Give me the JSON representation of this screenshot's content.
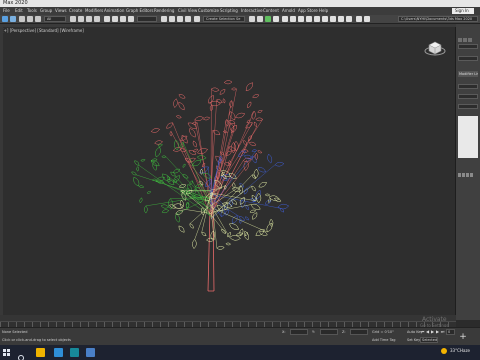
{
  "window": {
    "title": "Max 2020"
  },
  "menu": {
    "items": [
      "File",
      "Edit",
      "Tools",
      "Group",
      "Views",
      "Create",
      "Modifiers",
      "Animation",
      "Graph Editors",
      "Rendering",
      "Civil View",
      "Customize",
      "Scripting",
      "Interactive",
      "Content",
      "Arnold",
      "App Store",
      "Help"
    ],
    "sign_in": "Sign In"
  },
  "toolbar": {
    "selection_filter": "All",
    "named_selection": "Create Selection Se",
    "workspace_path": "C:\\Users\\NYHI\\Documents\\3ds Max 2020"
  },
  "viewport": {
    "label": "[+] [Perspective] [Standard] [Wireframe]"
  },
  "command_panel": {
    "modifier_list": "Modifier List"
  },
  "statusbar": {
    "selection_info": "None Selected",
    "hint": "Click or click-and-drag to select objects",
    "x_label": "X:",
    "y_label": "Y:",
    "z_label": "Z:",
    "grid": "Grid = 0'10\"",
    "add_time_tag": "Add Time Tag",
    "auto_key": "Auto Key",
    "set_key": "Set Key",
    "selected": "Selected",
    "frame": "0"
  },
  "watermark": {
    "line1": "Activate",
    "line2": "Go to Settings"
  },
  "taskbar": {
    "weather": "33°C",
    "condition": "Haze"
  },
  "colors": {
    "accent": "#f4b400",
    "viewport_bg": "#2e2e2e",
    "tree_red": "#e86a6a",
    "tree_green": "#3fbf3f",
    "tree_yellow": "#e6f0a8",
    "tree_blue": "#3f5fd8"
  }
}
